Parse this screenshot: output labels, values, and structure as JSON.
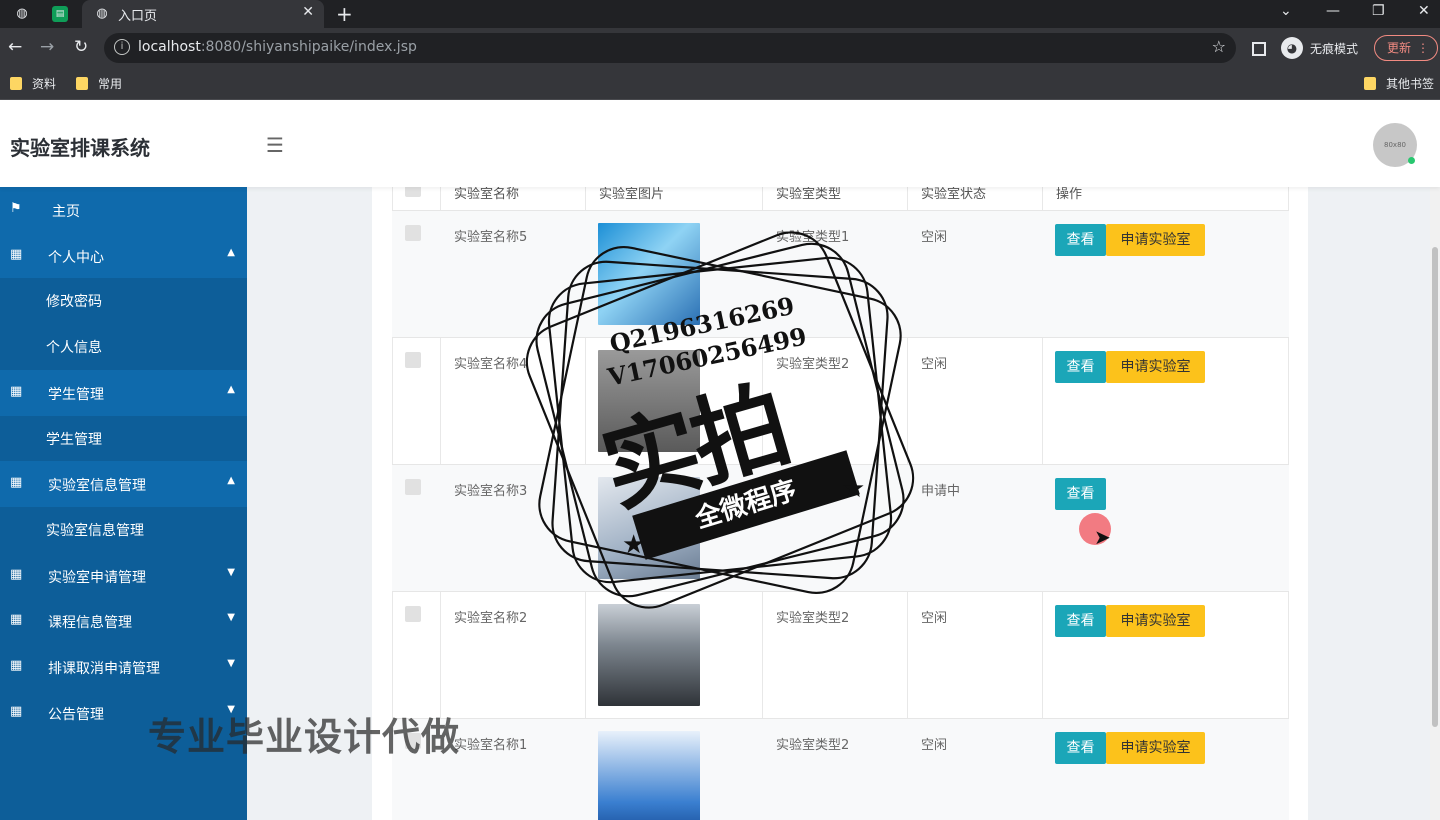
{
  "browser": {
    "tab_title": "入口页",
    "url_host": "localhost",
    "url_rest": ":8080/shiyanshipaike/index.jsp",
    "incognito_label": "无痕模式",
    "update_label": "更新",
    "bookmarks": [
      "资料",
      "常用"
    ],
    "other_bookmarks": "其他书签"
  },
  "app": {
    "title": "实验室排课系统",
    "avatar_text": "80x80"
  },
  "sidebar": {
    "home": "主页",
    "personal_center": "个人中心",
    "change_password": "修改密码",
    "personal_info": "个人信息",
    "student_mgmt": "学生管理",
    "student_mgmt_sub": "学生管理",
    "lab_info_mgmt": "实验室信息管理",
    "lab_info_mgmt_sub": "实验室信息管理",
    "lab_apply_mgmt": "实验室申请管理",
    "course_info_mgmt": "课程信息管理",
    "cancel_apply_mgmt": "排课取消申请管理",
    "notice_mgmt": "公告管理"
  },
  "table": {
    "headers": [
      "实验室名称",
      "实验室图片",
      "实验室类型",
      "实验室状态",
      "操作"
    ],
    "view_label": "查看",
    "apply_label": "申请实验室",
    "rows": [
      {
        "name": "实验室名称5",
        "type": "实验室类型1",
        "status": "空闲"
      },
      {
        "name": "实验室名称4",
        "type": "实验室类型2",
        "status": "空闲"
      },
      {
        "name": "实验室名称3",
        "type": "",
        "status": "申请中"
      },
      {
        "name": "实验室名称2",
        "type": "实验室类型2",
        "status": "空闲"
      },
      {
        "name": "实验室名称1",
        "type": "实验室类型2",
        "status": "空闲"
      }
    ]
  },
  "overlay": {
    "watermark": "专业毕业设计代做",
    "stamp_qq": "Q2196316269",
    "stamp_vx": "V17060256499",
    "stamp_big": "实拍",
    "stamp_ribbon": "全微程序"
  },
  "colors": {
    "sidebar_bg": "#0d5e99",
    "view_button": "#1ba6b8",
    "apply_button": "#fcc21b"
  }
}
